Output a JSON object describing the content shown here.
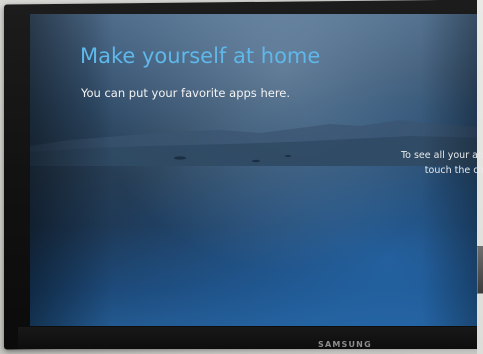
{
  "screen": {
    "title": "Make yourself at home",
    "subtitle": "You can put your favorite apps here.",
    "hint_lines": [
      "To see all your app",
      "touch the circ"
    ]
  },
  "monitor": {
    "brand": "SAMSUNG"
  },
  "colors": {
    "title": "#5fb8ea",
    "text": "#f3f3f3",
    "bezel": "#111111",
    "wallpaper": "#2a435d"
  }
}
